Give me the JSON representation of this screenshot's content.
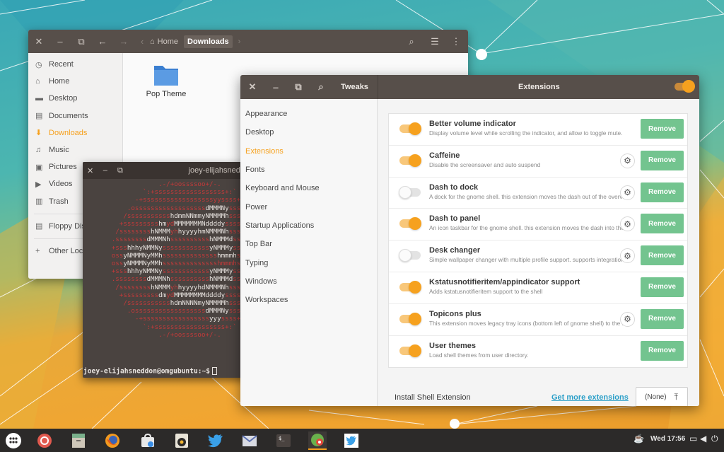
{
  "files": {
    "breadcrumb": {
      "home": "Home",
      "current": "Downloads"
    },
    "sidebar": [
      {
        "label": "Recent",
        "icon": "clock-icon"
      },
      {
        "label": "Home",
        "icon": "home-icon"
      },
      {
        "label": "Desktop",
        "icon": "desktop-folder-icon"
      },
      {
        "label": "Documents",
        "icon": "documents-icon"
      },
      {
        "label": "Downloads",
        "icon": "downloads-icon",
        "active": true
      },
      {
        "label": "Music",
        "icon": "music-icon"
      },
      {
        "label": "Pictures",
        "icon": "pictures-icon"
      },
      {
        "label": "Videos",
        "icon": "videos-icon"
      },
      {
        "label": "Trash",
        "icon": "trash-icon"
      },
      {
        "label": "Floppy Disk",
        "icon": "floppy-icon"
      },
      {
        "label": "Other Locations",
        "icon": "plus-icon"
      }
    ],
    "folder_name": "Pop Theme",
    "accent": "#f6a11e"
  },
  "terminal": {
    "title": "joey-elijahsneddon@omgubuntu: ~",
    "prompt": "joey-elijahsneddon@omgubuntu:~$"
  },
  "tweaks": {
    "title": "Tweaks",
    "panel_title": "Extensions",
    "nav": [
      "Appearance",
      "Desktop",
      "Extensions",
      "Fonts",
      "Keyboard and Mouse",
      "Power",
      "Startup Applications",
      "Top Bar",
      "Typing",
      "Windows",
      "Workspaces"
    ],
    "active_nav": "Extensions",
    "extensions": [
      {
        "name": "Better volume indicator",
        "desc": "Display volume level while scrolling the indicator, and allow to toggle mute.",
        "on": true,
        "gear": false
      },
      {
        "name": "Caffeine",
        "desc": "Disable the screensaver and auto suspend",
        "on": true,
        "gear": true
      },
      {
        "name": "Dash to dock",
        "desc": "A dock for the gnome shell. this extension moves the dash out of the overview.",
        "on": false,
        "gear": true
      },
      {
        "name": "Dash to panel",
        "desc": "An icon taskbar for the gnome shell. this extension moves the dash into the panel.",
        "on": true,
        "gear": true
      },
      {
        "name": "Desk changer",
        "desc": "Simple wallpaper changer with multiple profile support. supports integration.",
        "on": false,
        "gear": true
      },
      {
        "name": "Kstatusnotifieritem/appindicator support",
        "desc": "Adds kstatusnotifieritem support to the shell",
        "on": true,
        "gear": false
      },
      {
        "name": "Topicons plus",
        "desc": "This extension moves legacy tray icons (bottom left of gnome shell) to the top panel.",
        "on": true,
        "gear": true
      },
      {
        "name": "User themes",
        "desc": "Load shell themes from user directory.",
        "on": true,
        "gear": false
      }
    ],
    "remove_label": "Remove",
    "install_label": "Install Shell Extension",
    "get_more": "Get more extensions",
    "none_label": "(None)"
  },
  "taskbar": {
    "clock": "Wed 17:56",
    "apps": [
      "apps-grid-icon",
      "chrome-icon",
      "files-icon",
      "firefox-icon",
      "software-store-icon",
      "rhythmbox-icon",
      "twitter-icon",
      "mail-icon",
      "terminal-icon",
      "tweaks-icon",
      "twitter-alt-icon"
    ]
  }
}
